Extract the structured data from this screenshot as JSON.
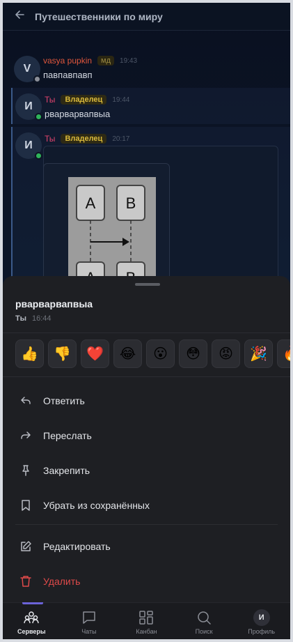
{
  "header": {
    "title": "Путешественники по миру"
  },
  "messages": [
    {
      "avatar_letter": "V",
      "author": "vasya pupkin",
      "badge": "мд",
      "time": "19:43",
      "text": "павпавпавп",
      "status_color": "#8b8f99"
    },
    {
      "avatar_letter": "И",
      "author": "Ты",
      "badge": "Владелец",
      "time": "19:44",
      "text": "рварварвапвыа",
      "status_color": "#2fb35a"
    },
    {
      "avatar_letter": "И",
      "author": "Ты",
      "badge": "Владелец",
      "time": "20:17",
      "text": "",
      "status_color": "#2fb35a"
    }
  ],
  "diagram": {
    "labels": [
      "A",
      "B",
      "A",
      "B"
    ]
  },
  "sheet": {
    "message_text": "рварварвапвыа",
    "author": "Ты",
    "time": "16:44",
    "reactions": [
      {
        "emoji": "👍",
        "name": "thumbs-up"
      },
      {
        "emoji": "👎",
        "name": "thumbs-down"
      },
      {
        "emoji": "❤️",
        "name": "heart"
      },
      {
        "emoji": "😂",
        "name": "joy"
      },
      {
        "emoji": "😮",
        "name": "open-mouth"
      },
      {
        "emoji": "😳",
        "name": "flushed"
      },
      {
        "emoji": "😡",
        "name": "angry"
      },
      {
        "emoji": "🎉",
        "name": "party"
      },
      {
        "emoji": "🔥",
        "name": "fire"
      }
    ],
    "actions": {
      "reply": "Ответить",
      "forward": "Переслать",
      "pin": "Закрепить",
      "unsave": "Убрать из сохранённых",
      "edit": "Редактировать",
      "delete": "Удалить"
    }
  },
  "tabs": {
    "servers": "Серверы",
    "chats": "Чаты",
    "kanban": "Канбан",
    "search": "Поиск",
    "profile": "Профиль",
    "profile_letter": "И"
  },
  "colors": {
    "accent": "#6b63d8",
    "danger": "#e04a4a",
    "owner_badge": "#d9b93c"
  }
}
